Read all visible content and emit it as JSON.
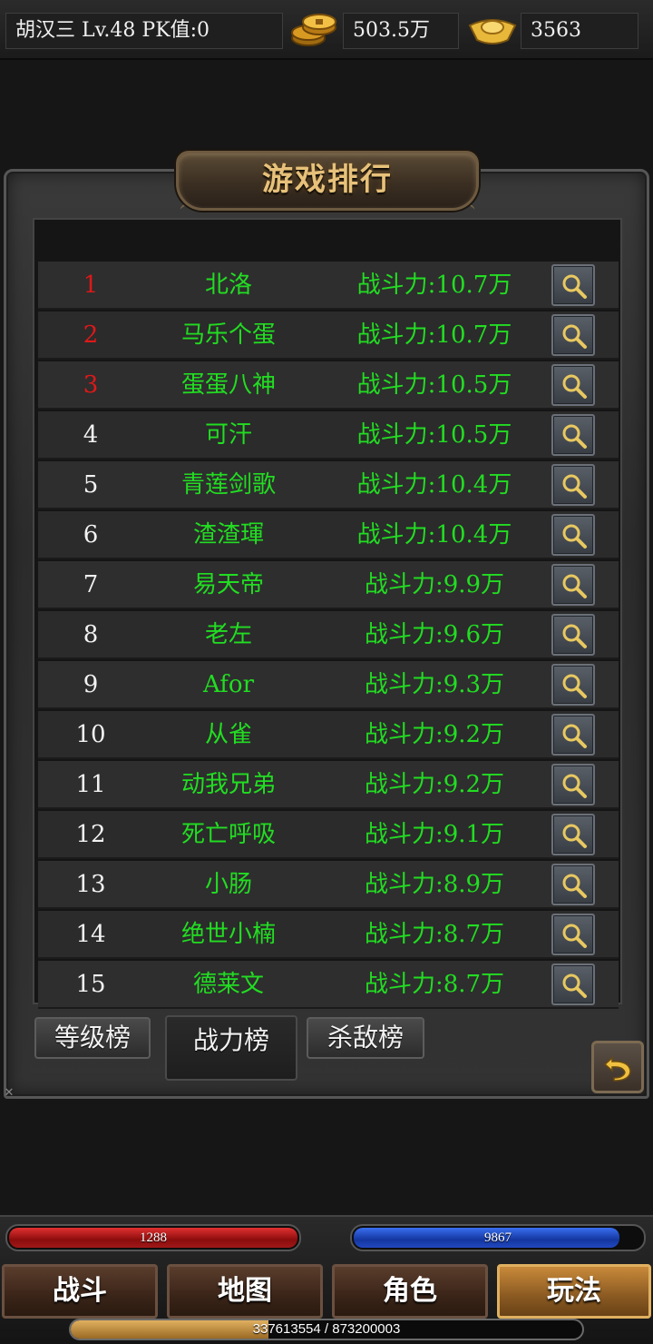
{
  "player": {
    "info": "胡汉三  Lv.48 PK值:0",
    "gold": "503.5万",
    "ingot": "3563"
  },
  "panel": {
    "title": "游戏排行"
  },
  "ranking": [
    {
      "rank": "1",
      "name": "北洛",
      "power": "战斗力:10.7万",
      "top": true
    },
    {
      "rank": "2",
      "name": "马乐个蛋",
      "power": "战斗力:10.7万",
      "top": true
    },
    {
      "rank": "3",
      "name": "蛋蛋八神",
      "power": "战斗力:10.5万",
      "top": true
    },
    {
      "rank": "4",
      "name": "可汗",
      "power": "战斗力:10.5万",
      "top": false
    },
    {
      "rank": "5",
      "name": "青莲剑歌",
      "power": "战斗力:10.4万",
      "top": false
    },
    {
      "rank": "6",
      "name": "渣渣琿",
      "power": "战斗力:10.4万",
      "top": false
    },
    {
      "rank": "7",
      "name": "易天帝",
      "power": "战斗力:9.9万",
      "top": false
    },
    {
      "rank": "8",
      "name": "老左",
      "power": "战斗力:9.6万",
      "top": false
    },
    {
      "rank": "9",
      "name": "Afor",
      "power": "战斗力:9.3万",
      "top": false
    },
    {
      "rank": "10",
      "name": "从雀",
      "power": "战斗力:9.2万",
      "top": false
    },
    {
      "rank": "11",
      "name": "动我兄弟",
      "power": "战斗力:9.2万",
      "top": false
    },
    {
      "rank": "12",
      "name": "死亡呼吸",
      "power": "战斗力:9.1万",
      "top": false
    },
    {
      "rank": "13",
      "name": "小肠",
      "power": "战斗力:8.9万",
      "top": false
    },
    {
      "rank": "14",
      "name": "绝世小楠",
      "power": "战斗力:8.7万",
      "top": false
    },
    {
      "rank": "15",
      "name": "德莱文",
      "power": "战斗力:8.7万",
      "top": false
    }
  ],
  "row_button_icon": "magnifier-icon",
  "tabs": {
    "level": "等级榜",
    "power": "战力榜",
    "kill": "杀敌榜",
    "active": "power"
  },
  "hud": {
    "hp": "1288",
    "hp_fraction": 1.0,
    "mp": "9867",
    "mp_fraction": 0.92,
    "exp": "337613554 / 873200003",
    "exp_fraction": 0.387
  },
  "nav": {
    "battle": "战斗",
    "map": "地图",
    "role": "角色",
    "play": "玩法",
    "active": "play"
  },
  "colors": {
    "top_rank": "#e01818",
    "name_green": "#22dd22",
    "title_gold": "#e7c17a"
  }
}
